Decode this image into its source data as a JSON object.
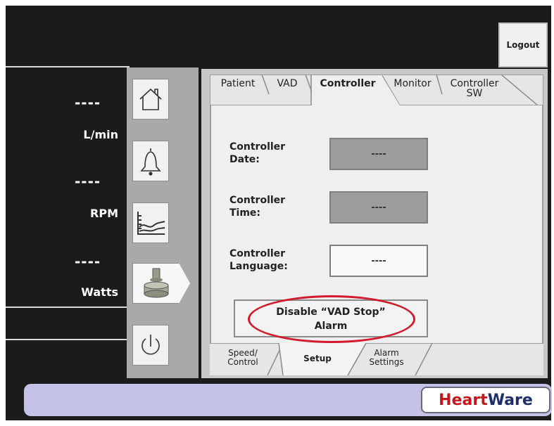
{
  "header": {
    "logout_label": "Logout"
  },
  "readouts": [
    {
      "value": "----",
      "unit": "L/min"
    },
    {
      "value": "----",
      "unit": "RPM"
    },
    {
      "value": "----",
      "unit": "Watts"
    }
  ],
  "nav": {
    "items": [
      {
        "icon": "home-icon"
      },
      {
        "icon": "bell-icon"
      },
      {
        "icon": "trend-chart-icon"
      },
      {
        "icon": "pump-controller-icon",
        "active": true
      },
      {
        "icon": "power-icon"
      }
    ]
  },
  "top_tabs": [
    {
      "label": "Patient"
    },
    {
      "label": "VAD"
    },
    {
      "label": "Controller",
      "active": true
    },
    {
      "label": "Monitor"
    },
    {
      "label_line1": "Controller",
      "label_line2": "SW"
    }
  ],
  "fields": [
    {
      "label_line1": "Controller",
      "label_line2": "Date:",
      "value": "----"
    },
    {
      "label_line1": "Controller",
      "label_line2": "Time:",
      "value": "----"
    },
    {
      "label_line1": "Controller",
      "label_line2": "Language:",
      "value": "----"
    }
  ],
  "disable_button": {
    "line1": "Disable “VAD Stop”",
    "line2": "Alarm"
  },
  "bottom_tabs": [
    {
      "line1": "Speed/",
      "line2": "Control"
    },
    {
      "line1": "Setup",
      "active": true
    },
    {
      "line1": "Alarm",
      "line2": "Settings"
    }
  ],
  "logo": {
    "part1": "Heart",
    "part2": "Ware"
  },
  "colors": {
    "highlight_ellipse": "#d01c2c",
    "logo_red": "#c2171c",
    "logo_navy": "#1f2f6b",
    "footer": "#c5c2e8"
  }
}
